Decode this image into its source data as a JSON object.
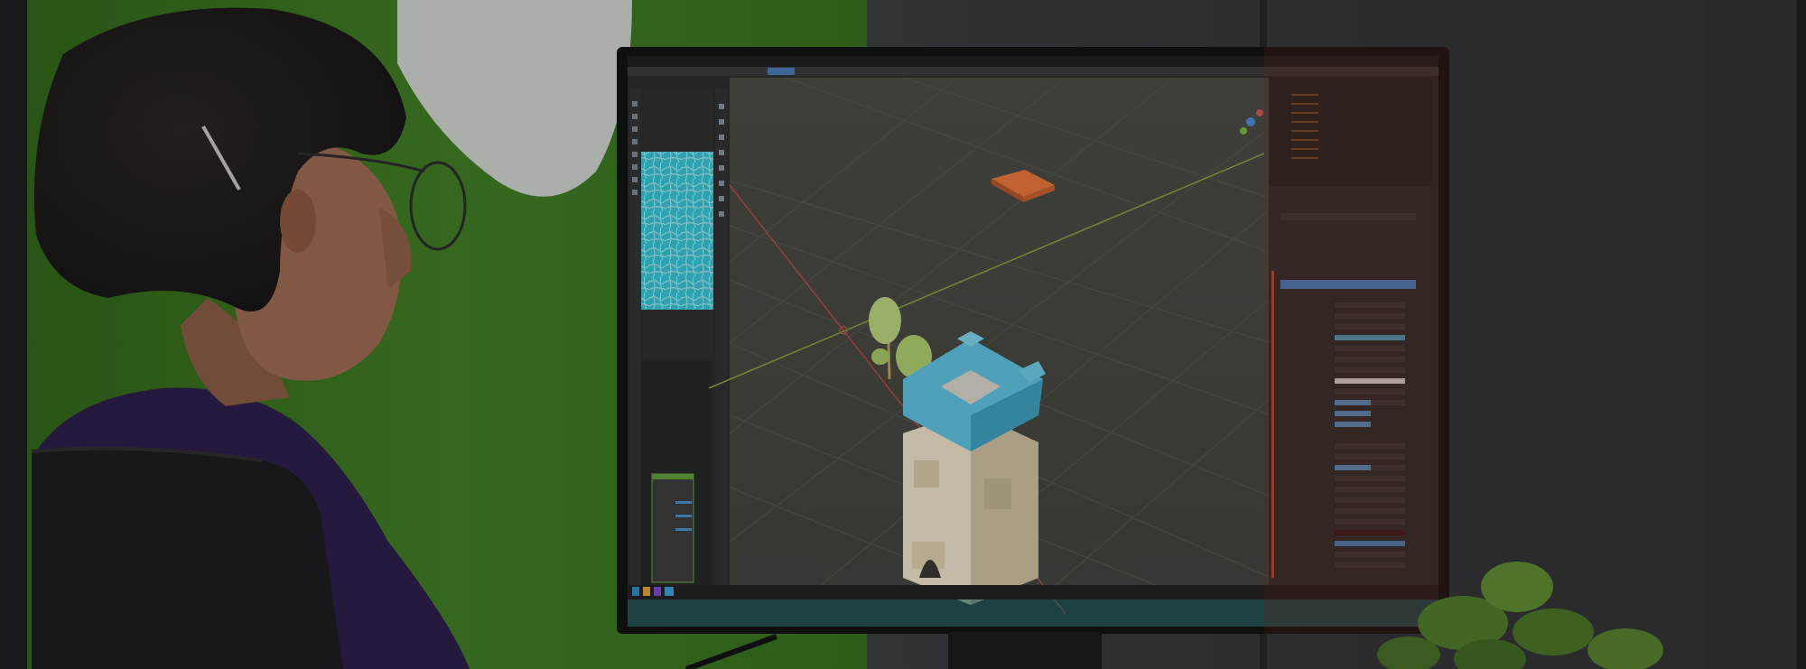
{
  "photo": {
    "subject": "",
    "screen": {
      "application": "",
      "viewport": {
        "objects": [
          "tower",
          "tree",
          "orange-tile"
        ]
      },
      "colors": {
        "viewport_bg": "#4a4a44",
        "panel_bg": "#2b2b2b",
        "accent_blue": "#4a90c8",
        "texture_cyan": "#33c6d6",
        "tower_body": "#e8dcc0",
        "tower_roof": "#56bede",
        "tile_orange": "#e8763a",
        "tree_green": "#b4d27a"
      }
    },
    "environment": {
      "wall_green": "#3e7a22",
      "shirt": "#2c1f4a"
    }
  }
}
